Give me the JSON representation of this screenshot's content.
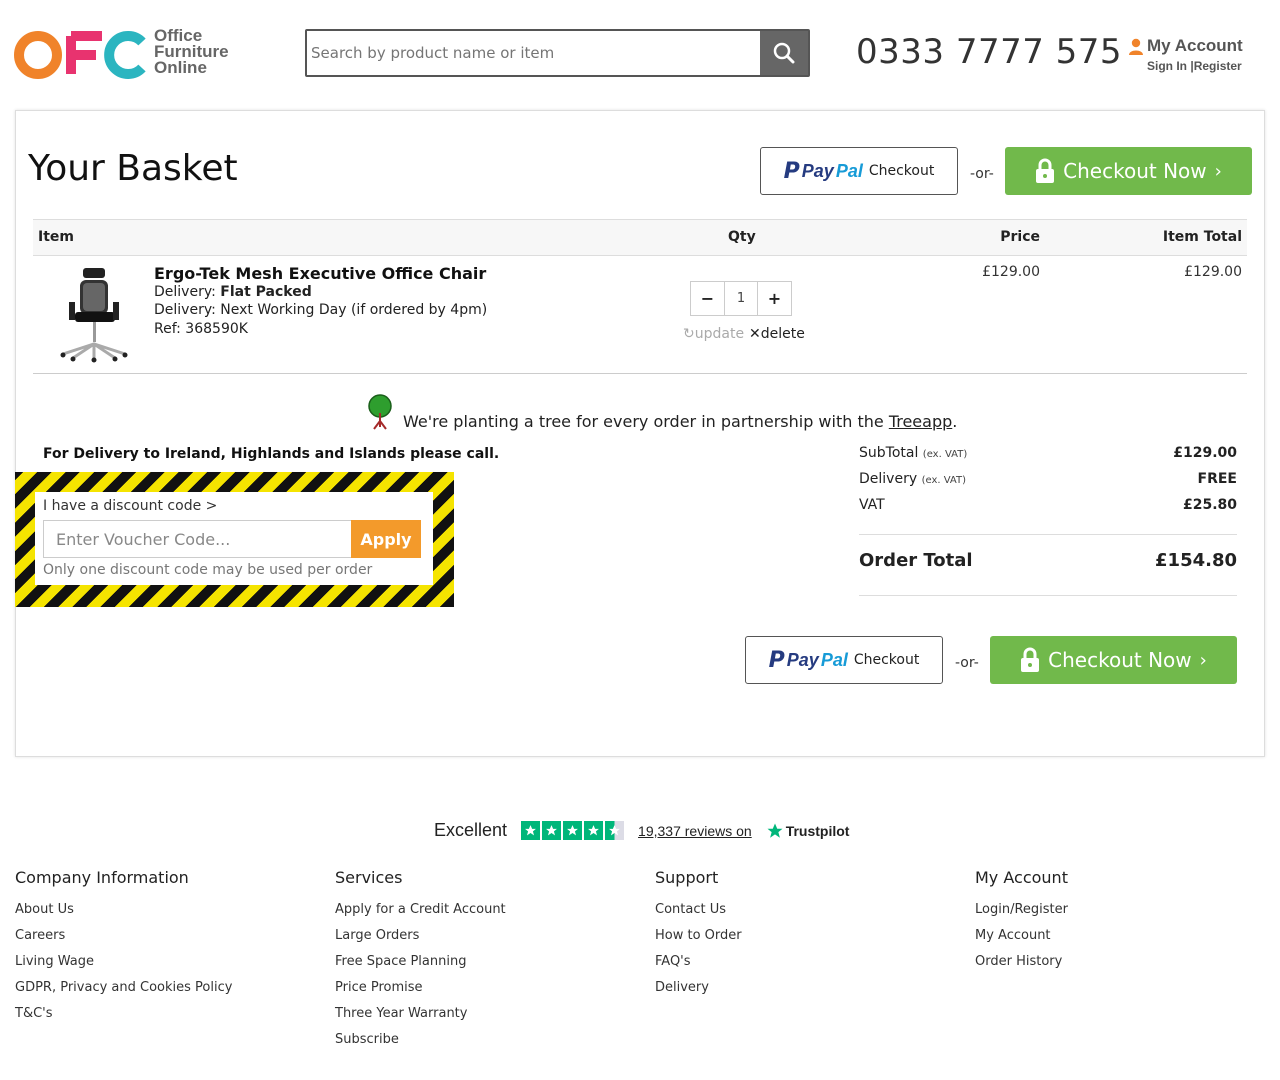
{
  "header": {
    "logo_lines": [
      "Office",
      "Furniture",
      "Online"
    ],
    "search_placeholder": "Search by product name or item",
    "phone": "0333 7777 575",
    "account_title": "My Account",
    "sign_in": "Sign In",
    "register": "Register"
  },
  "basket": {
    "title": "Your Basket",
    "paypal_word1": "Pay",
    "paypal_word2": "Pal",
    "paypal_checkout": "Checkout",
    "or": "-or-",
    "checkout_now": "Checkout Now",
    "columns": {
      "item": "Item",
      "qty": "Qty",
      "price": "Price",
      "item_total": "Item Total"
    },
    "item": {
      "name": "Ergo-Tek Mesh Executive Office Chair",
      "delivery_label": "Delivery:",
      "delivery_type": "Flat Packed",
      "delivery_time": "Delivery: Next Working Day (if ordered by 4pm)",
      "ref": "Ref: 368590K",
      "qty": "1",
      "update": "update",
      "delete": "delete",
      "price": "£129.00",
      "item_total": "£129.00"
    },
    "tree_text": "We're planting a tree for every order in partnership with the ",
    "tree_link": "Treeapp",
    "tree_period": ".",
    "delivery_note": "For Delivery to Ireland, Highlands and Islands please call.",
    "discount": {
      "label": "I have a discount code >",
      "placeholder": "Enter Voucher Code...",
      "apply": "Apply",
      "note": "Only one discount code may be used per order"
    },
    "totals": {
      "subtotal_label": "SubTotal",
      "ex_vat": "(ex. VAT)",
      "subtotal": "£129.00",
      "delivery_label": "Delivery",
      "delivery": "FREE",
      "vat_label": "VAT",
      "vat": "£25.80",
      "order_total_label": "Order Total",
      "order_total": "£154.80"
    }
  },
  "trustpilot": {
    "rating_word": "Excellent",
    "reviews": "19,337 reviews on",
    "brand": "Trustpilot",
    "stars": 4.5
  },
  "footer": {
    "columns": [
      {
        "title": "Company Information",
        "links": [
          "About Us",
          "Careers",
          "Living Wage",
          "GDPR, Privacy and Cookies Policy",
          "T&C's"
        ]
      },
      {
        "title": "Services",
        "links": [
          "Apply for a Credit Account",
          "Large Orders",
          "Free Space Planning",
          "Price Promise",
          "Three Year Warranty",
          "Subscribe"
        ]
      },
      {
        "title": "Support",
        "links": [
          "Contact Us",
          "How to Order",
          "FAQ's",
          "Delivery"
        ]
      },
      {
        "title": "My Account",
        "links": [
          "Login/Register",
          "My Account",
          "Order History"
        ]
      }
    ]
  },
  "colors": {
    "checkout_green": "#71b94b",
    "apply_orange": "#f39a2b",
    "logo_orange": "#f0832a",
    "logo_pink": "#e8336f",
    "logo_teal": "#2bb5c0",
    "trustpilot_green": "#00b67a"
  }
}
